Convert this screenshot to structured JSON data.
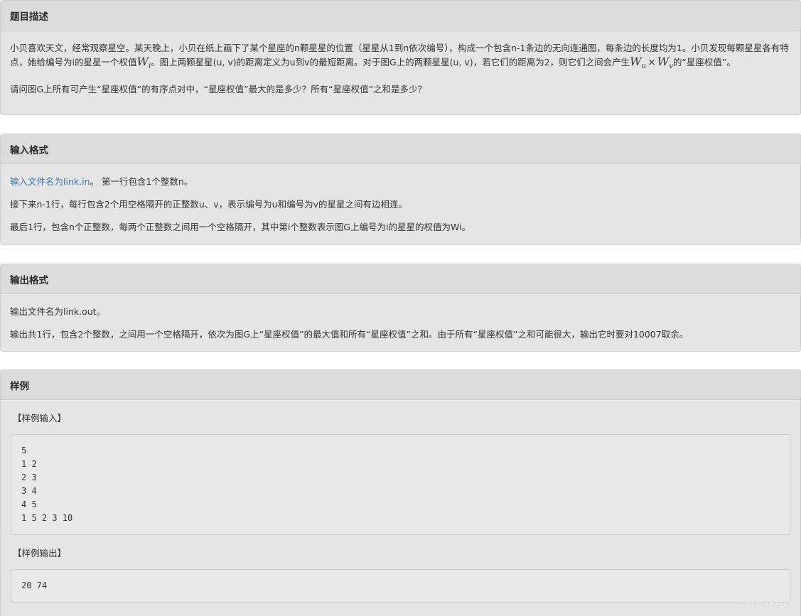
{
  "description": {
    "heading": "题目描述",
    "p1_a": "小贝喜欢天文，经常观察星空。某天晚上，小贝在纸上画下了某个星座的n颗星星的位置（星星从1到n依次编号），构成一个包含n-1条边的无向连通图，每条边的长度均为1。小贝发现每颗星星各有特点，她给编号为i的星星一个权值",
    "p1_b": "。图上两颗星星(u, v)的距离定义为u到v的最短距离。对于图G上的两颗星星(u, v)，若它们的距离为2，则它们之间会产生",
    "p1_c": "的“星座权值”。",
    "p2": "请问图G上所有可产生“星座权值”的有序点对中，“星座权值”最大的是多少？所有“星座权值”之和是多少？",
    "math_W": "W",
    "math_i": "i",
    "math_u": "u",
    "math_v": "v",
    "math_times": "×"
  },
  "input_format": {
    "heading": "输入格式",
    "link_text": "输入文件名为link.in",
    "p1_rest": "。 第一行包含1个整数n。",
    "p2": "接下来n-1行，每行包含2个用空格隔开的正整数u、v，表示编号为u和编号为v的星星之间有边相连。",
    "p3": "最后1行，包含n个正整数，每两个正整数之间用一个空格隔开，其中第i个整数表示图G上编号为i的星星的权值为Wi。"
  },
  "output_format": {
    "heading": "输出格式",
    "p1": "输出文件名为link.out。",
    "p2": "输出共1行，包含2个整数，之间用一个空格隔开，依次为图G上“星座权值”的最大值和所有“星座权值”之和。由于所有“星座权值”之和可能很大，输出它时要对10007取余。"
  },
  "sample": {
    "heading": "样例",
    "input_label": "【样例输入】",
    "input_text": "5\n1 2\n2 3\n3 4\n4 5\n1 5 2 3 10",
    "output_label": "【样例输出】",
    "output_text": "20 74"
  },
  "watermark": "CSDN @Ayane."
}
